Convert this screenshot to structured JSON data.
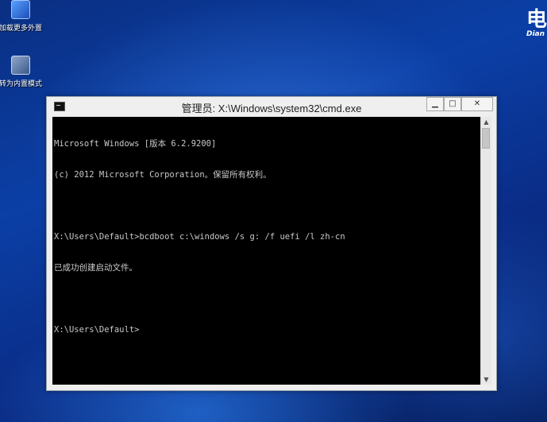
{
  "desktop": {
    "icons": [
      {
        "label": "加载更多外置",
        "icon": "network-icon"
      },
      {
        "label": "转为内置模式",
        "icon": "shortcut-icon"
      }
    ],
    "brand": {
      "big": "电",
      "small": "Dian"
    }
  },
  "window": {
    "title": "管理员: X:\\Windows\\system32\\cmd.exe",
    "controls": {
      "minimize": "▁",
      "maximize": "□",
      "close": "✕"
    }
  },
  "console": {
    "lines": [
      "Microsoft Windows [版本 6.2.9200]",
      "(c) 2012 Microsoft Corporation。保留所有权利。",
      "",
      "X:\\Users\\Default>bcdboot c:\\windows /s g: /f uefi /l zh-cn",
      "已成功创建启动文件。",
      "",
      "X:\\Users\\Default>"
    ]
  },
  "scrollbar": {
    "up": "▲",
    "down": "▼"
  }
}
